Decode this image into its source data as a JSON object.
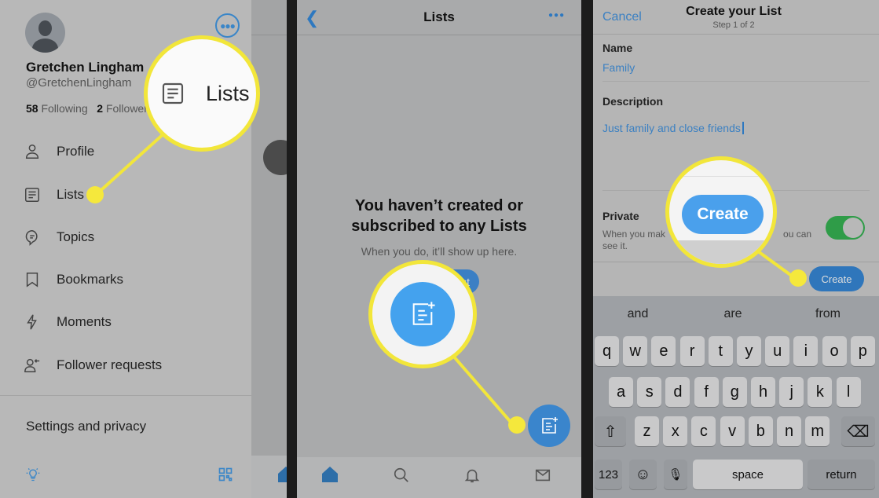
{
  "panel1": {
    "name": "Gretchen Lingham",
    "handle": "@GretchenLingham",
    "following_count": "58",
    "following_label": "Following",
    "followers_count": "2",
    "followers_label": "Followers",
    "menu": [
      {
        "label": "Profile",
        "icon": "person-icon"
      },
      {
        "label": "Lists",
        "icon": "list-icon"
      },
      {
        "label": "Topics",
        "icon": "topic-icon"
      },
      {
        "label": "Bookmarks",
        "icon": "bookmark-icon"
      },
      {
        "label": "Moments",
        "icon": "lightning-icon"
      },
      {
        "label": "Follower requests",
        "icon": "follower-request-icon"
      }
    ],
    "settings": "Settings and privacy",
    "magnifier_label": "Lists"
  },
  "panel2": {
    "title": "Lists",
    "empty_title": "You haven’t created or subscribed to any Lists",
    "empty_subtitle": "When you do, it’ll show up here.",
    "create_button_partial": "st"
  },
  "panel3": {
    "cancel": "Cancel",
    "title": "Create your List",
    "step": "Step 1 of 2",
    "name_label": "Name",
    "name_value": "Family",
    "description_label": "Description",
    "description_value": "Just family and close friends",
    "private_label": "Private",
    "private_desc_left": "When you mak",
    "private_desc_right": "ou can",
    "private_desc_line2": "see it.",
    "private_on": true,
    "create": "Create",
    "magnifier_create": "Create",
    "keyboard": {
      "suggestions": [
        "and",
        "are",
        "from"
      ],
      "row1": [
        "q",
        "w",
        "e",
        "r",
        "t",
        "y",
        "u",
        "i",
        "o",
        "p"
      ],
      "row2": [
        "a",
        "s",
        "d",
        "f",
        "g",
        "h",
        "j",
        "k",
        "l"
      ],
      "row3": [
        "z",
        "x",
        "c",
        "v",
        "b",
        "n",
        "m"
      ],
      "numbers": "123",
      "space": "space",
      "return": "return"
    }
  },
  "colors": {
    "accent": "#3b95e6",
    "highlight": "#f2e63a",
    "toggle": "#2f9c48"
  }
}
